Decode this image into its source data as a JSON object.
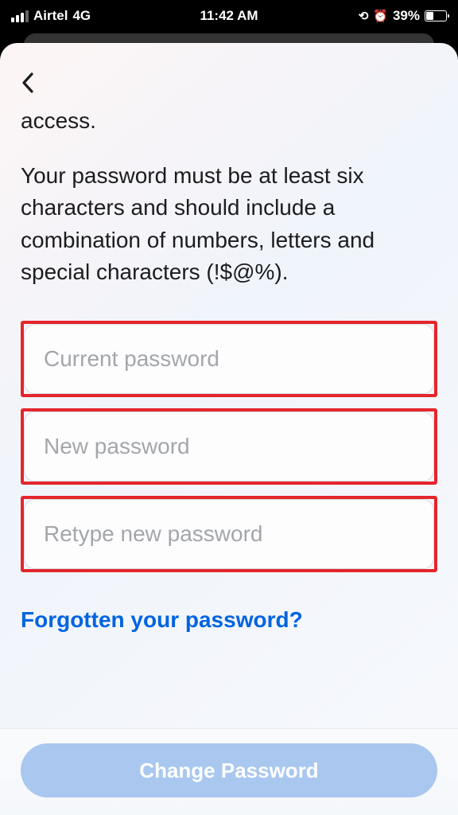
{
  "status": {
    "carrier": "Airtel",
    "network": "4G",
    "time": "11:42 AM",
    "battery_percent": "39%",
    "rotation_lock_icon": "⊘",
    "alarm_icon": "⏰"
  },
  "content": {
    "desc_line1": "access.",
    "desc_line2": "Your password must be at least six characters and should include a combination of numbers, letters and special characters (!$@%)."
  },
  "fields": {
    "current_placeholder": "Current password",
    "new_placeholder": "New password",
    "retype_placeholder": "Retype new password"
  },
  "links": {
    "forgot": "Forgotten your password?"
  },
  "actions": {
    "submit": "Change Password"
  }
}
